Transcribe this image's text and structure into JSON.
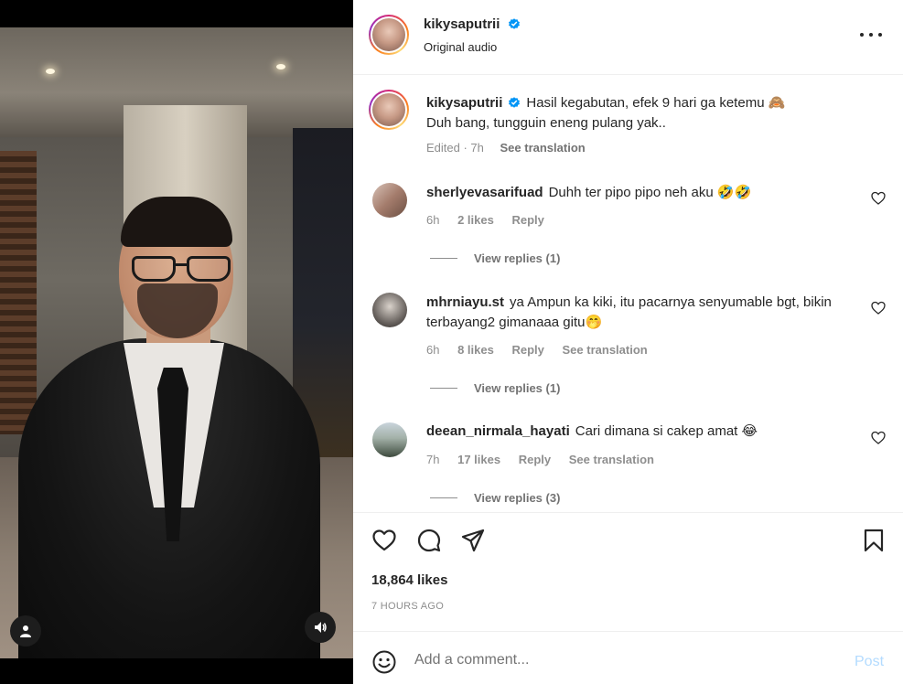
{
  "colors": {
    "accent": "#0095f6",
    "text": "#262626",
    "muted": "#8e8e8e",
    "post_disabled": "#b3dbff"
  },
  "header": {
    "username": "kikysaputrii",
    "audio": "Original audio",
    "more_icon": "more-horizontal-icon"
  },
  "caption": {
    "username": "kikysaputrii",
    "text_line1": "Hasil kegabutan, efek 9 hari ga ketemu 🙈",
    "text_line2": "Duh bang, tungguin eneng pulang yak..",
    "edited": "Edited · 7h",
    "see_translation": "See translation"
  },
  "comments": [
    {
      "username": "sherlyevasarifuad",
      "text": "Duhh ter pipo pipo neh aku 🤣🤣",
      "time": "6h",
      "likes": "2 likes",
      "reply": "Reply",
      "view_replies": "View replies (1)"
    },
    {
      "username": "mhrniayu.st",
      "text": "ya Ampun ka kiki, itu pacarnya senyumable bgt, bikin terbayang2 gimanaaa gitu🤭",
      "time": "6h",
      "likes": "8 likes",
      "reply": "Reply",
      "see_translation": "See translation",
      "view_replies": "View replies (1)"
    },
    {
      "username": "deean_nirmala_hayati",
      "text": "Cari dimana si cakep amat 😂",
      "time": "7h",
      "likes": "17 likes",
      "reply": "Reply",
      "see_translation": "See translation",
      "view_replies": "View replies (3)"
    }
  ],
  "stats": {
    "likes": "18,864 likes",
    "ago": "7 HOURS AGO"
  },
  "comment_box": {
    "placeholder": "Add a comment...",
    "post": "Post"
  }
}
